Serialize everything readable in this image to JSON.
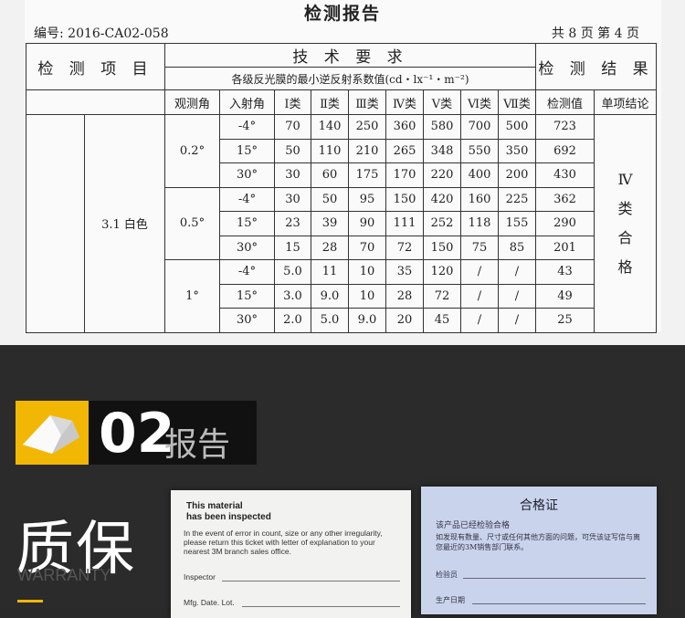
{
  "report": {
    "title": "检测报告",
    "code": "编号: 2016-CA02-058",
    "pages": "共 8 页   第 4 页",
    "head_item": "检 测 项 目",
    "head_req": "技 术 要 求",
    "head_req_sub": "各级反光膜的最小逆反射系数值(cd・lx⁻¹・m⁻²)",
    "head_result": "检 测 结 果",
    "cols": {
      "obs": "观测角",
      "inc": "入射角",
      "c1": "Ⅰ类",
      "c2": "Ⅱ类",
      "c3": "Ⅲ类",
      "c4": "Ⅳ类",
      "c5": "Ⅴ类",
      "c6": "Ⅵ类",
      "c7": "Ⅶ类",
      "measured": "检测值",
      "conclusion": "单项结论"
    },
    "item": "3.1 白色",
    "obs_angles": [
      "0.2°",
      "0.5°",
      "1°"
    ],
    "rows": [
      {
        "inc": "-4°",
        "v": [
          "70",
          "140",
          "250",
          "360",
          "580",
          "700",
          "500"
        ],
        "m": "723"
      },
      {
        "inc": "15°",
        "v": [
          "50",
          "110",
          "210",
          "265",
          "348",
          "550",
          "350"
        ],
        "m": "692"
      },
      {
        "inc": "30°",
        "v": [
          "30",
          "60",
          "175",
          "170",
          "220",
          "400",
          "200"
        ],
        "m": "430"
      },
      {
        "inc": "-4°",
        "v": [
          "30",
          "50",
          "95",
          "150",
          "420",
          "160",
          "225"
        ],
        "m": "362"
      },
      {
        "inc": "15°",
        "v": [
          "23",
          "39",
          "90",
          "111",
          "252",
          "118",
          "155"
        ],
        "m": "290"
      },
      {
        "inc": "30°",
        "v": [
          "15",
          "28",
          "70",
          "72",
          "150",
          "75",
          "85"
        ],
        "m": "201"
      },
      {
        "inc": "-4°",
        "v": [
          "5.0",
          "11",
          "10",
          "35",
          "120",
          "/",
          "/"
        ],
        "m": "43"
      },
      {
        "inc": "15°",
        "v": [
          "3.0",
          "9.0",
          "10",
          "28",
          "72",
          "/",
          "/"
        ],
        "m": "49"
      },
      {
        "inc": "30°",
        "v": [
          "2.0",
          "5.0",
          "9.0",
          "20",
          "45",
          "/",
          "/"
        ],
        "m": "25"
      }
    ],
    "verdict": [
      "Ⅳ",
      "类",
      "合",
      "格"
    ]
  },
  "section": {
    "number": "02",
    "label": "报告",
    "warranty_cn": "质保",
    "warranty_en": "WARRANTY"
  },
  "ticket": {
    "title_line1": "This material",
    "title_line2": "has been inspected",
    "body": "In the event of error in count, size or any other irregularity, please return this ticket with letter of explanation to your nearest 3M branch sales office.",
    "inspector": "Inspector",
    "mfg": "Mfg. Date. Lot."
  },
  "cert": {
    "title": "合格证",
    "line1": "该产品已经检验合格",
    "line2": "如发现有数量、尺寸或任何其他方面的问题，可凭该证写信与离您最近的3M销售部门联系。",
    "inspector": "检验员",
    "date": "生产日期"
  },
  "colors": {
    "accent": "#f2b705",
    "dark": "#2b2b2b"
  }
}
